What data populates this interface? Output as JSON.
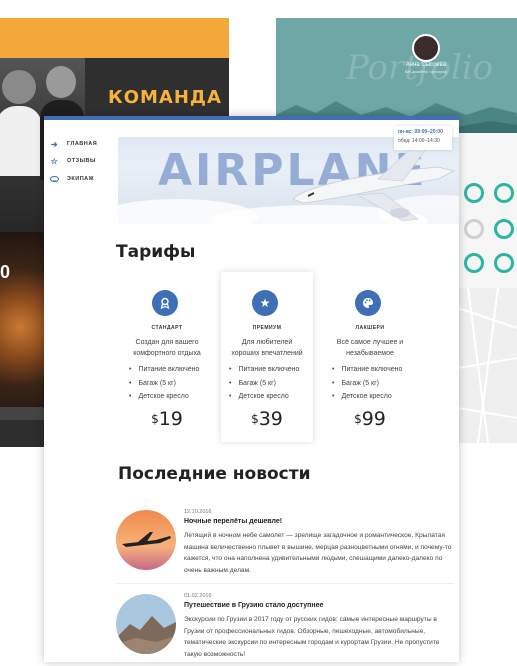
{
  "background": {
    "team_title": "КОМАНДА",
    "food_label": "0",
    "portfolio_watermark": "Portfolio",
    "portfolio_name": "Анна Сысоева",
    "portfolio_sub": "Веб-дизайнер / фотограф"
  },
  "nav": {
    "items": [
      {
        "label": "ГЛАВНАЯ",
        "icon": "arrow-right-icon"
      },
      {
        "label": "ОТЗЫВЫ",
        "icon": "star-icon"
      },
      {
        "label": "ЭКИПАЖ",
        "icon": "cap-icon"
      }
    ]
  },
  "hero": {
    "title": "AIRPLANE",
    "hours_line1": "пн-вс: 09:00–20:00",
    "hours_line2": "обед: 14:00–14:30"
  },
  "tariffs": {
    "heading": "Тарифы",
    "plans": [
      {
        "name": "СТАНДАРТ",
        "icon": "badge-icon",
        "desc": "Создан для вашего комфортного отдыха",
        "features": [
          "Питание включено",
          "Багаж (5 кг)",
          "Детское кресло"
        ],
        "currency": "$",
        "price": "19"
      },
      {
        "name": "ПРЕМИУМ",
        "icon": "star-icon",
        "desc": "Для любителей хороших впечатлений",
        "features": [
          "Питание включено",
          "Багаж (5 кг)",
          "Детское кресло"
        ],
        "currency": "$",
        "price": "39"
      },
      {
        "name": "ЛАКШЕРИ",
        "icon": "palette-icon",
        "desc": "Всё самое лучшее и незабываемое",
        "features": [
          "Питание включено",
          "Багаж (5 кг)",
          "Детское кресло"
        ],
        "currency": "$",
        "price": "99"
      }
    ]
  },
  "news": {
    "heading": "Последние новости",
    "items": [
      {
        "date": "12.10.2016",
        "title": "Ночные перелёты дешевле!",
        "text": "Летящий в ночном небе самолет — зрелище загадочное и романтическое. Крылатая машина величественно плывет в вышине, мерцая разноцветными огнями, и почему-то кажется, что она наполнена удивительными людьми, спешащими далеко-далеко по очень важным делам."
      },
      {
        "date": "01.02.2016",
        "title": "Путешествие в Грузию стало доступнее",
        "text": "Экскурсии по Грузии в 2017 году от русских гидов: самые интересные маршруты в Грузии от профессиональных гидов. Обзорные, пешеходные, автомобильные, тематические экскурсии по интересным городам и курортам Грузии. Не пропустите такую возможность!"
      }
    ]
  },
  "colors": {
    "accent": "#3f6fb4",
    "teal": "#6fa7a6",
    "orange": "#f3a83a"
  }
}
